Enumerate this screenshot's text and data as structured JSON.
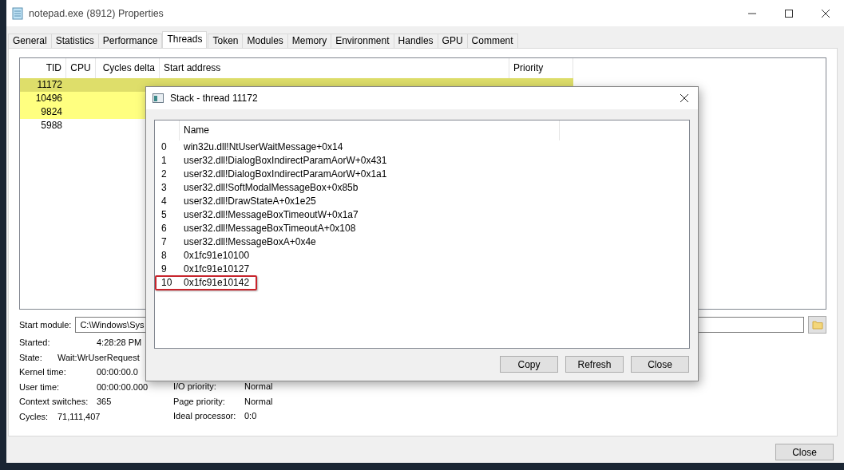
{
  "window": {
    "title": "notepad.exe (8912) Properties"
  },
  "tabs": [
    {
      "label": "General",
      "selected": false
    },
    {
      "label": "Statistics",
      "selected": false
    },
    {
      "label": "Performance",
      "selected": false
    },
    {
      "label": "Threads",
      "selected": true
    },
    {
      "label": "Token",
      "selected": false
    },
    {
      "label": "Modules",
      "selected": false
    },
    {
      "label": "Memory",
      "selected": false
    },
    {
      "label": "Environment",
      "selected": false
    },
    {
      "label": "Handles",
      "selected": false
    },
    {
      "label": "GPU",
      "selected": false
    },
    {
      "label": "Comment",
      "selected": false
    }
  ],
  "threads": {
    "columns": [
      "TID",
      "CPU",
      "Cycles delta",
      "Start address",
      "Priority"
    ],
    "rows": [
      {
        "tid": "11172",
        "highlighted": true,
        "selected": true
      },
      {
        "tid": "10496",
        "highlighted": true,
        "selected": false
      },
      {
        "tid": "9824",
        "highlighted": true,
        "selected": false
      },
      {
        "tid": "5988",
        "highlighted": false,
        "selected": false
      }
    ]
  },
  "start_module": {
    "label": "Start module:",
    "value": "C:\\Windows\\Sys"
  },
  "details_left": [
    {
      "label": "Started:",
      "value": "4:28:28 PM",
      "kind": "wide"
    },
    {
      "label": "State:",
      "value": "Wait:WrUserRequest",
      "kind": "narrow"
    },
    {
      "label": "Kernel time:",
      "value": "00:00:00.0",
      "kind": "wide"
    },
    {
      "label": "User time:",
      "value": "00:00:00.000",
      "kind": "wide"
    },
    {
      "label": "Context switches:",
      "value": "365",
      "kind": "wide"
    },
    {
      "label": "Cycles:",
      "value": "71,111,407",
      "kind": "narrow"
    }
  ],
  "details_right": [
    {
      "label": "I/O priority:",
      "value": "Normal"
    },
    {
      "label": "Page priority:",
      "value": "Normal"
    },
    {
      "label": "Ideal processor:",
      "value": "0:0"
    }
  ],
  "close_button": "Close",
  "stack_dialog": {
    "title": "Stack - thread 11172",
    "column": "Name",
    "frames": [
      {
        "index": "0",
        "name": "win32u.dll!NtUserWaitMessage+0x14",
        "boxed": false
      },
      {
        "index": "1",
        "name": "user32.dll!DialogBoxIndirectParamAorW+0x431",
        "boxed": false
      },
      {
        "index": "2",
        "name": "user32.dll!DialogBoxIndirectParamAorW+0x1a1",
        "boxed": false
      },
      {
        "index": "3",
        "name": "user32.dll!SoftModalMessageBox+0x85b",
        "boxed": false
      },
      {
        "index": "4",
        "name": "user32.dll!DrawStateA+0x1e25",
        "boxed": false
      },
      {
        "index": "5",
        "name": "user32.dll!MessageBoxTimeoutW+0x1a7",
        "boxed": false
      },
      {
        "index": "6",
        "name": "user32.dll!MessageBoxTimeoutA+0x108",
        "boxed": false
      },
      {
        "index": "7",
        "name": "user32.dll!MessageBoxA+0x4e",
        "boxed": false
      },
      {
        "index": "8",
        "name": "0x1fc91e10100",
        "boxed": false
      },
      {
        "index": "9",
        "name": "0x1fc91e10127",
        "boxed": false
      },
      {
        "index": "10",
        "name": "0x1fc91e10142",
        "boxed": true
      }
    ],
    "buttons": [
      "Copy",
      "Refresh",
      "Close"
    ]
  }
}
